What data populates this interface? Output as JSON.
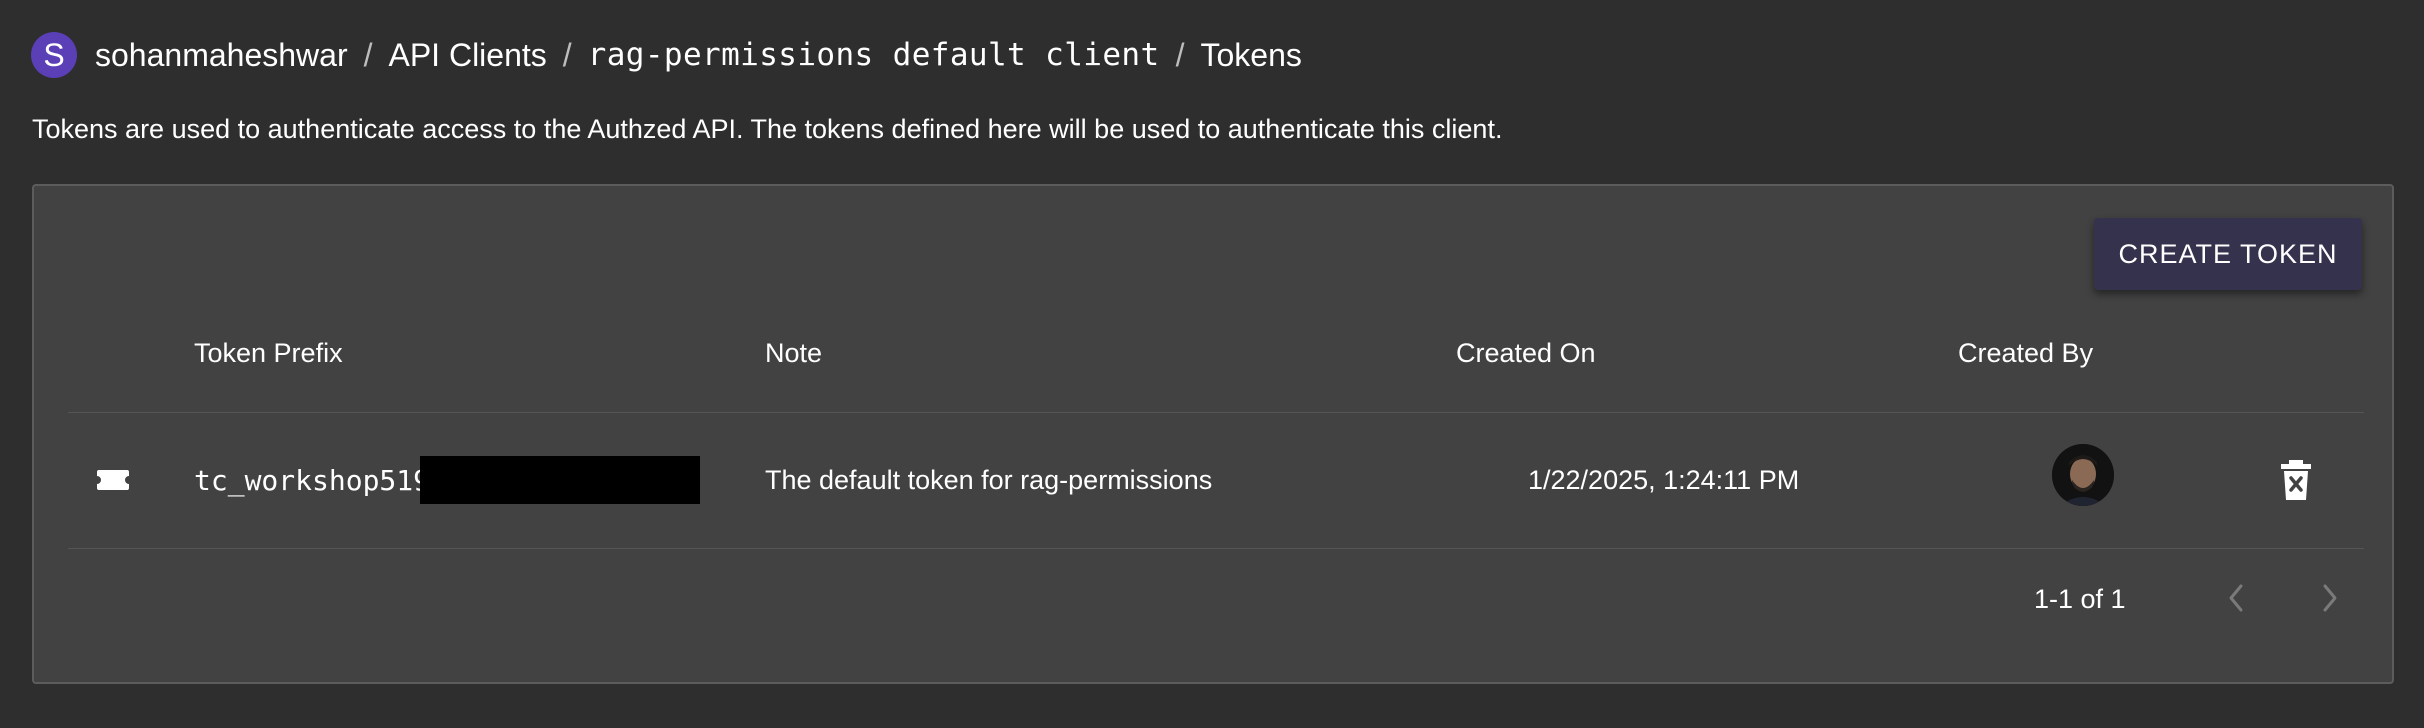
{
  "breadcrumb": {
    "avatar_letter": "S",
    "org": "sohanmaheshwar",
    "separator": "/",
    "api_clients": "API Clients",
    "client": "rag-permissions default client",
    "tokens": "Tokens"
  },
  "description": "Tokens are used to authenticate access to the Authzed API. The tokens defined here will be used to authenticate this client.",
  "actions": {
    "create_token": "CREATE TOKEN"
  },
  "table": {
    "columns": [
      "Token Prefix",
      "Note",
      "Created On",
      "Created By"
    ],
    "rows": [
      {
        "icon": "ticket-icon",
        "token_prefix": "tc_workshop519",
        "note": "The default token for rag-permissions",
        "created_on": "1/22/2025, 1:24:11 PM",
        "created_by_icon": "user-avatar",
        "action_icon": "delete-icon"
      }
    ]
  },
  "pagination": {
    "range": "1-1 of 1",
    "prev_icon": "chevron-left-icon",
    "next_icon": "chevron-right-icon"
  },
  "colors": {
    "background": "#2e2e2e",
    "panel": "#424242",
    "accent_avatar": "#5b3fb6",
    "button": "#34324d"
  }
}
